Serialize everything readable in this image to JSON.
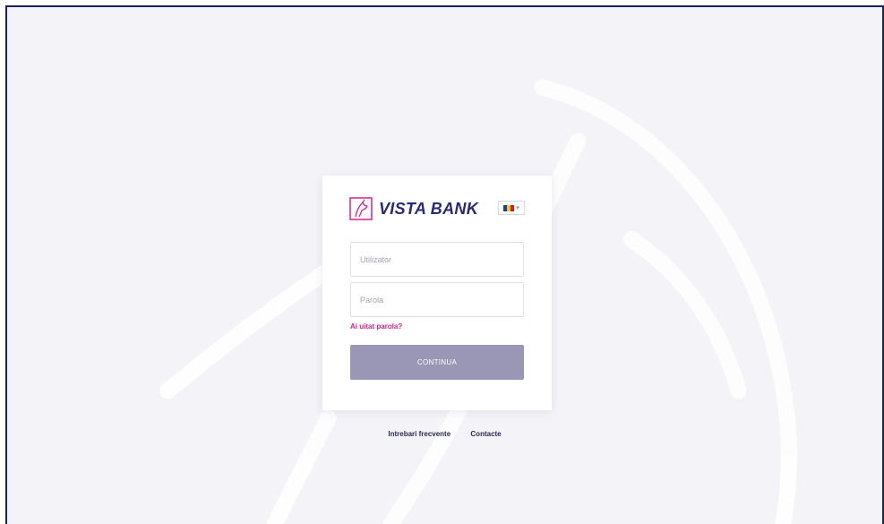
{
  "brand": {
    "name": "VISTA BANK",
    "logo_icon": "horse-head-logo-icon",
    "primary_color": "#2a2878",
    "accent_color": "#d6228f"
  },
  "language": {
    "selected_flag": "ro-flag-icon",
    "flag_colors": [
      "#1f3f9a",
      "#f4c91c",
      "#cc1f2c"
    ],
    "dropdown_icon": "chevron-down-icon"
  },
  "login": {
    "username_placeholder": "Utilizator",
    "username_value": "",
    "password_placeholder": "Parola",
    "password_value": "",
    "forgot_password": "Ai uitat parola?",
    "submit_label": "CONTINUA",
    "submit_color": "#9a97b6"
  },
  "footer": {
    "faq": "Intrebari frecvente",
    "contacts": "Contacte"
  },
  "background": {
    "watermark_icon": "horse-watermark-icon",
    "color": "#f4f3f8"
  }
}
